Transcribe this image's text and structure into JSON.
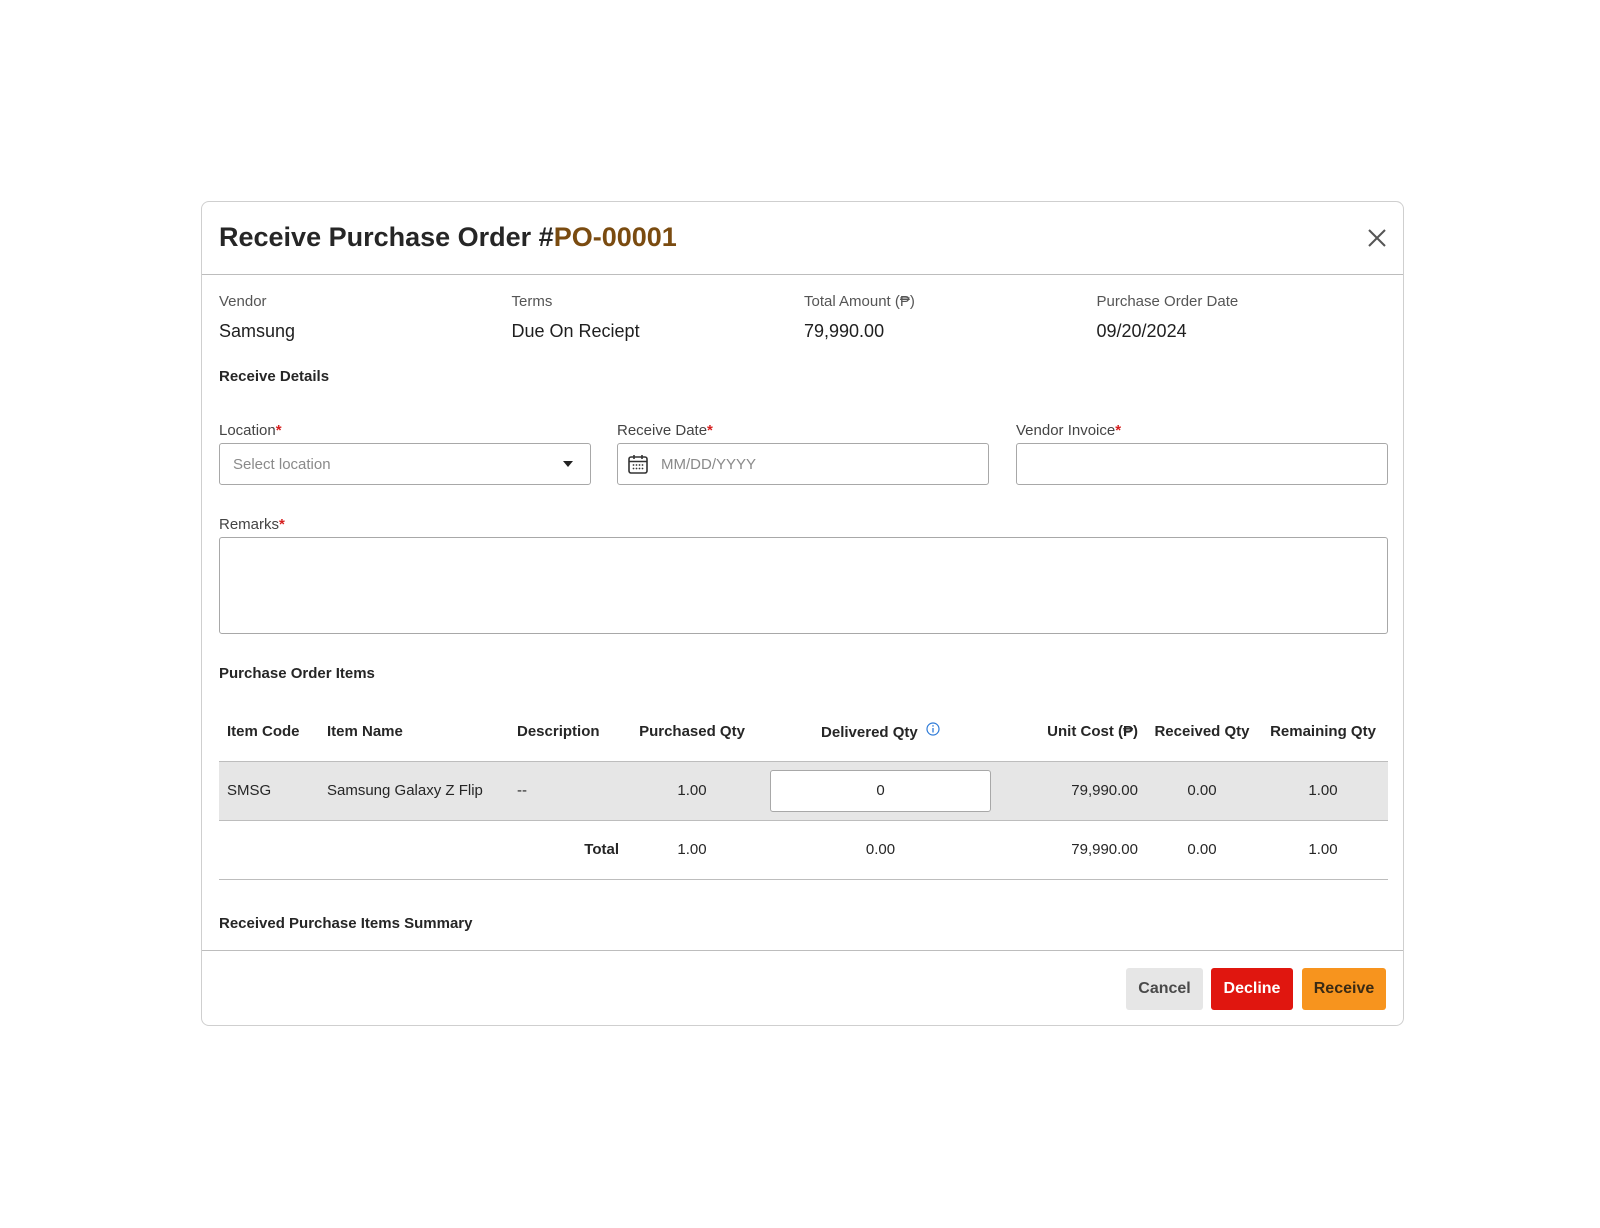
{
  "modal": {
    "title_prefix": "Receive Purchase Order #",
    "po_number": "PO-00001"
  },
  "summary": [
    {
      "label": "Vendor",
      "value": "Samsung"
    },
    {
      "label": "Terms",
      "value": "Due On Reciept"
    },
    {
      "label": "Total Amount (₱)",
      "value": "79,990.00"
    },
    {
      "label": "Purchase Order Date",
      "value": "09/20/2024"
    }
  ],
  "receive_details": {
    "title": "Receive Details",
    "location_label": "Location",
    "location_placeholder": "Select location",
    "receive_date_label": "Receive Date",
    "receive_date_placeholder": "MM/DD/YYYY",
    "vendor_invoice_label": "Vendor Invoice",
    "vendor_invoice_value": "",
    "remarks_label": "Remarks",
    "remarks_value": "",
    "required_mark": "*"
  },
  "items": {
    "title": "Purchase Order Items",
    "columns": [
      "Item Code",
      "Item Name",
      "Description",
      "Purchased Qty",
      "Delivered Qty",
      "Unit Cost (₱)",
      "Received Qty",
      "Remaining Qty"
    ],
    "rows": [
      {
        "item_code": "SMSG",
        "item_name": "Samsung Galaxy Z Flip",
        "description": "--",
        "purchased_qty": "1.00",
        "delivered_qty": "0",
        "unit_cost": "79,990.00",
        "received_qty": "0.00",
        "remaining_qty": "1.00"
      }
    ],
    "total": {
      "label": "Total",
      "purchased_qty": "1.00",
      "delivered_qty": "0.00",
      "unit_cost": "79,990.00",
      "received_qty": "0.00",
      "remaining_qty": "1.00"
    }
  },
  "received_summary": {
    "title": "Received Purchase Items Summary"
  },
  "footer": {
    "cancel_label": "Cancel",
    "decline_label": "Decline",
    "receive_label": "Receive"
  },
  "colors": {
    "accent_brown": "#7a4b10",
    "decline_red": "#e0160f",
    "receive_orange": "#f7941e",
    "cancel_gray": "#e6e6e6",
    "info_blue": "#2f7bd8",
    "required_red": "#d61f1f"
  },
  "icons": {
    "close": "close-icon",
    "calendar": "calendar-icon",
    "dropdown": "chevron-down-icon",
    "info": "info-icon"
  }
}
